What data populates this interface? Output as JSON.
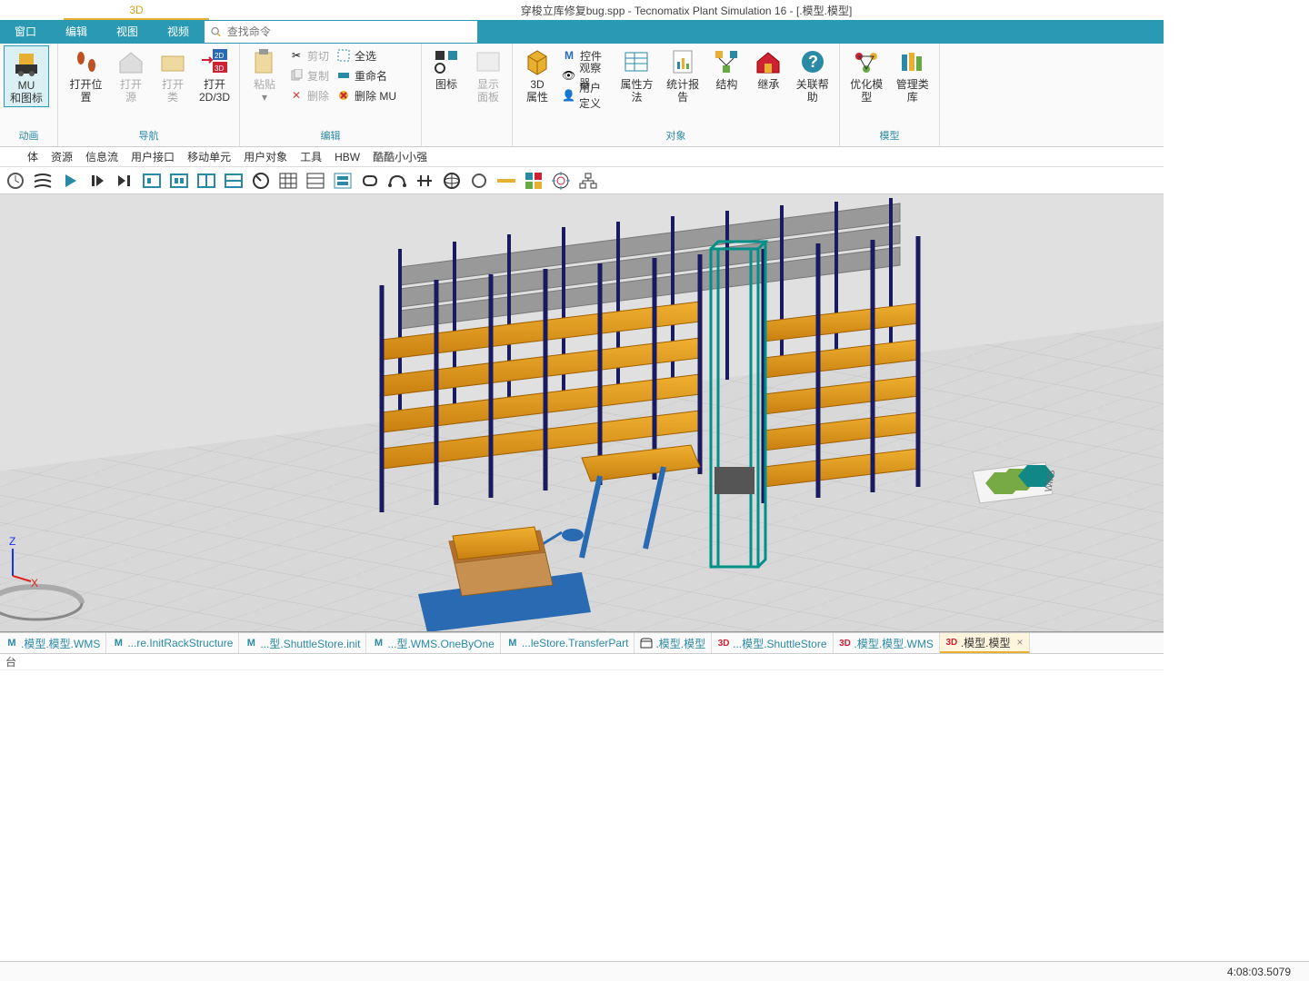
{
  "title": {
    "tab": "3D",
    "doc": "穿梭立库修复bug.spp - Tecnomatix Plant Simulation 16 - [.模型.模型]"
  },
  "menu": {
    "window": "窗口",
    "edit": "编辑",
    "view": "视图",
    "video": "视频",
    "search_placeholder": "查找命令"
  },
  "ribbon": {
    "g_anim": "动画",
    "mu_icon": "MU\n和图标",
    "g_nav": "导航",
    "open_pos": "打开位置",
    "open_src": "打开源",
    "open_class": "打开类",
    "open_2d3d": "打开\n2D/3D",
    "g_edit": "编辑",
    "paste": "粘贴",
    "cut": "剪切",
    "copy": "复制",
    "delete": "删除",
    "select_all": "全选",
    "rename": "重命名",
    "delmu": "删除 MU",
    "icons": "图标",
    "show_panel": "显示面板",
    "g_obj": "对象",
    "3d_prop": "3D\n属性",
    "prop_method": "属性方法",
    "stat_report": "统计报告",
    "controls": "控件",
    "observer": "观察器",
    "userdef": "用户定义",
    "struct": "结构",
    "inherit": "继承",
    "assoc_help": "关联帮助",
    "g_model": "模型",
    "opt_model": "优化模型",
    "manage_lib": "管理类库"
  },
  "classbar": {
    "i0": "体",
    "i1": "资源",
    "i2": "信息流",
    "i3": "用户接口",
    "i4": "移动单元",
    "i5": "用户对象",
    "i6": "工具",
    "i7": "HBW",
    "i8": "酷酷小小强"
  },
  "tabs": [
    {
      "icon": "M",
      "label": ".模型.模型.WMS"
    },
    {
      "icon": "M",
      "label": "...re.InitRackStructure"
    },
    {
      "icon": "M",
      "label": "...型.ShuttleStore.init"
    },
    {
      "icon": "M",
      "label": "...型.WMS.OneByOne"
    },
    {
      "icon": "M",
      "label": "...leStore.TransferPart"
    },
    {
      "icon": "F",
      "label": ".模型.模型"
    },
    {
      "icon": "3D",
      "label": "...模型.ShuttleStore"
    },
    {
      "icon": "3D",
      "label": ".模型.模型.WMS"
    },
    {
      "icon": "3D",
      "label": ".模型.模型",
      "active": true,
      "closable": true
    }
  ],
  "console": "台",
  "status": {
    "time": "4:08:03.5079"
  },
  "axis": {
    "z": "Z",
    "x": "X"
  },
  "viewport": {
    "label_wms": "WMS"
  }
}
